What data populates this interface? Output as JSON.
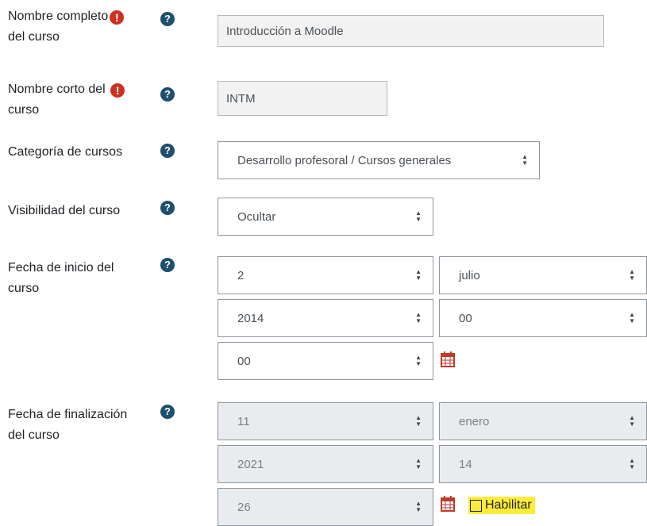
{
  "form": {
    "fullname": {
      "label_line1": "Nombre completo",
      "label_line2": "del curso",
      "required_glyph": "!",
      "help_glyph": "?",
      "value": "Introducción a Moodle"
    },
    "shortname": {
      "label_line1": "Nombre corto del",
      "label_line2": "curso",
      "required_glyph": "!",
      "help_glyph": "?",
      "value": "INTM"
    },
    "category": {
      "label": "Categoría de cursos",
      "help_glyph": "?",
      "selected": "Desarrollo profesoral / Cursos generales"
    },
    "visibility": {
      "label": "Visibilidad del curso",
      "help_glyph": "?",
      "selected": "Ocultar"
    },
    "startdate": {
      "label_line1": "Fecha de inicio del",
      "label_line2": "curso",
      "help_glyph": "?",
      "day": "2",
      "month": "julio",
      "year": "2014",
      "hour": "00",
      "minute": "00"
    },
    "enddate": {
      "label_line1": "Fecha de finalización",
      "label_line2": "del curso",
      "help_glyph": "?",
      "day": "11",
      "month": "enero",
      "year": "2021",
      "hour": "14",
      "minute": "26",
      "enable_label": "Habilitar",
      "enabled": false,
      "highlight_color": "#ffeb3b"
    }
  },
  "icons": {
    "required": "exclamation-circle-icon",
    "help": "question-circle-icon",
    "calendar": "calendar-icon"
  },
  "colors": {
    "required": "#ca3120",
    "help": "#1e4f6e",
    "calendar": "#c0392b"
  }
}
